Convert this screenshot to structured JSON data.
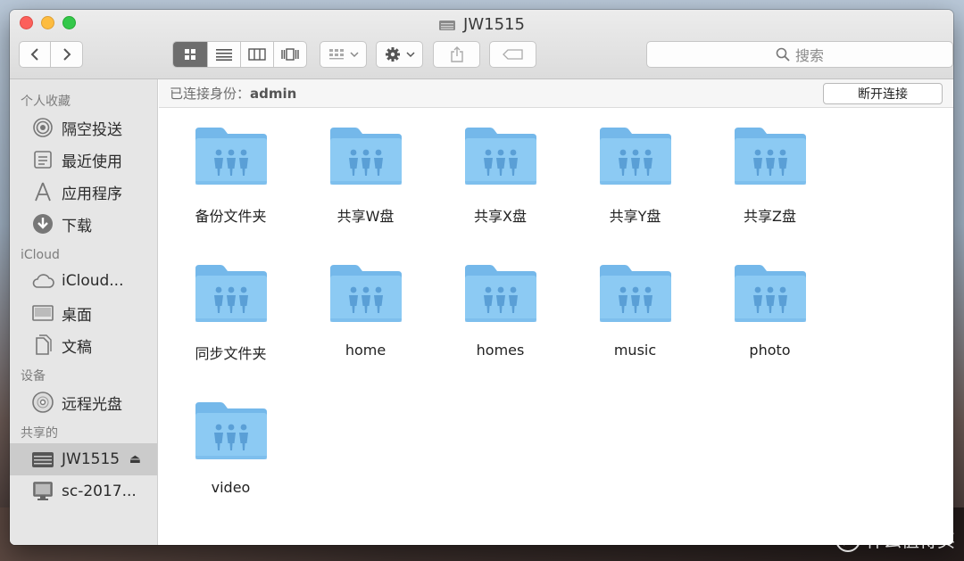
{
  "window": {
    "title": "JW1515"
  },
  "toolbar": {
    "back_icon": "chevron-left-icon",
    "forward_icon": "chevron-right-icon",
    "view_modes": [
      "icon-view",
      "list-view",
      "column-view",
      "cover-flow-view"
    ],
    "active_view": "icon-view",
    "search_placeholder": "搜索"
  },
  "pathbar": {
    "label": "已连接身份：",
    "user": "admin",
    "disconnect_label": "断开连接"
  },
  "sidebar": {
    "sections": [
      {
        "header": "个人收藏",
        "items": [
          {
            "label": "隔空投送",
            "icon": "airdrop-icon"
          },
          {
            "label": "最近使用",
            "icon": "recents-icon"
          },
          {
            "label": "应用程序",
            "icon": "applications-icon"
          },
          {
            "label": "下载",
            "icon": "download-icon"
          }
        ]
      },
      {
        "header": "iCloud",
        "items": [
          {
            "label": "iCloud...",
            "icon": "cloud-icon"
          },
          {
            "label": "桌面",
            "icon": "desktop-icon"
          },
          {
            "label": "文稿",
            "icon": "document-icon"
          }
        ]
      },
      {
        "header": "设备",
        "items": [
          {
            "label": "远程光盘",
            "icon": "disc-icon"
          }
        ]
      },
      {
        "header": "共享的",
        "items": [
          {
            "label": "JW1515",
            "icon": "nas-server-icon",
            "selected": true,
            "eject": "⏏"
          },
          {
            "label": "sc-2017...",
            "icon": "computer-icon"
          }
        ]
      }
    ]
  },
  "folders": [
    {
      "name": "备份文件夹"
    },
    {
      "name": "共享W盘"
    },
    {
      "name": "共享X盘"
    },
    {
      "name": "共享Y盘"
    },
    {
      "name": "共享Z盘"
    },
    {
      "name": "同步文件夹"
    },
    {
      "name": "home"
    },
    {
      "name": "homes"
    },
    {
      "name": "music"
    },
    {
      "name": "photo"
    },
    {
      "name": "video"
    }
  ],
  "watermark": {
    "badge": "值",
    "text": "什么值得买"
  },
  "colors": {
    "folder_body": "#8ccaf3",
    "folder_tab": "#74b8ea",
    "folder_glyph": "#5a9fd6"
  }
}
